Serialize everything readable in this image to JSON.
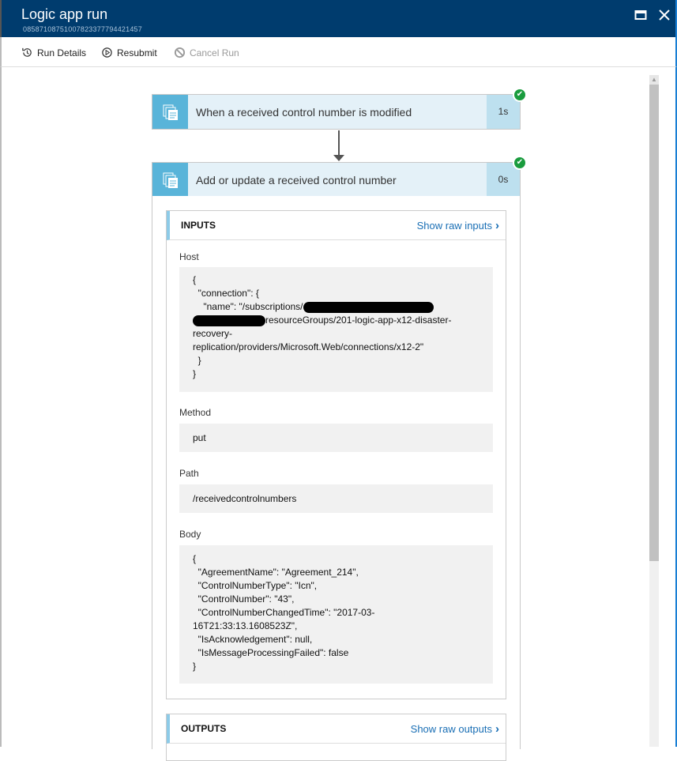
{
  "header": {
    "title": "Logic app run",
    "run_id": "08587108751007823377794421457",
    "maximize_icon": "maximize-icon",
    "close_icon": "close-icon"
  },
  "toolbar": {
    "run_details": "Run Details",
    "resubmit": "Resubmit",
    "cancel_run": "Cancel Run"
  },
  "steps": [
    {
      "label": "When a received control number is modified",
      "duration": "1s",
      "status": "succeeded"
    },
    {
      "label": "Add or update a received control number",
      "duration": "0s",
      "status": "succeeded"
    }
  ],
  "inputs": {
    "title": "INPUTS",
    "raw_link": "Show raw inputs",
    "host_label": "Host",
    "host_lines": [
      "{",
      "  \"connection\": {",
      "    \"name\": \"/subscriptions/",
      "resourceGroups/201-logic-app-x12-disaster-",
      "recovery-",
      "replication/providers/Microsoft.Web/connections/x12-2\"",
      "  }",
      "}"
    ],
    "method_label": "Method",
    "method": "put",
    "path_label": "Path",
    "path": "/receivedcontrolnumbers",
    "body_label": "Body",
    "body_lines": [
      "{",
      "  \"AgreementName\": \"Agreement_214\",",
      "  \"ControlNumberType\": \"Icn\",",
      "  \"ControlNumber\": \"43\",",
      "  \"ControlNumberChangedTime\": \"2017-03-",
      "16T21:33:13.1608523Z\",",
      "  \"IsAcknowledgement\": null,",
      "  \"IsMessageProcessingFailed\": false",
      "}"
    ]
  },
  "outputs": {
    "title": "OUTPUTS",
    "raw_link": "Show raw outputs"
  }
}
